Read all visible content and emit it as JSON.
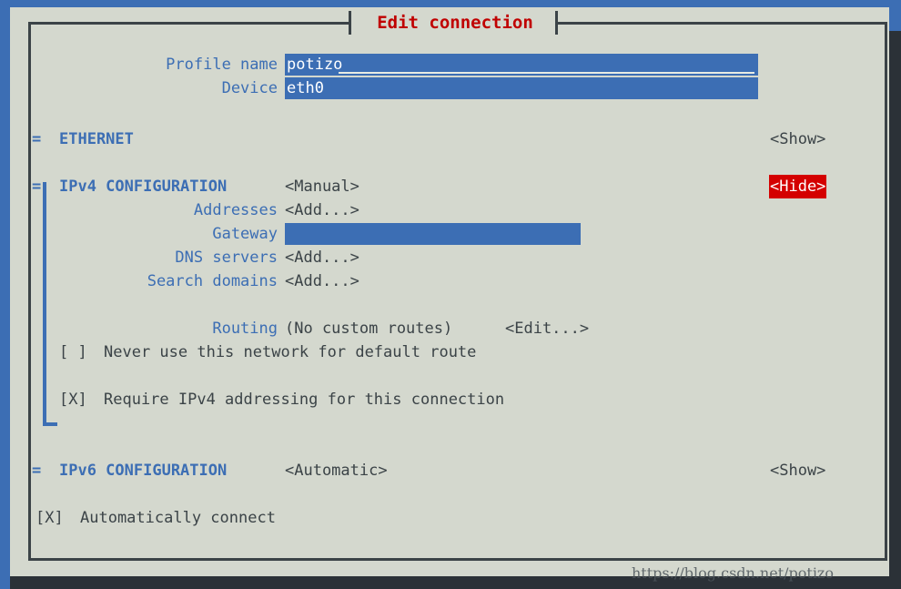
{
  "window": {
    "title": "Edit connection",
    "title_color": "#c00000",
    "background": "#d4d8ce",
    "border_color": "#3b4347",
    "accent_color": "#3c6eb4",
    "selected_bg": "#d40000"
  },
  "form": {
    "profile_name": {
      "label": "Profile name",
      "value": "potizo"
    },
    "device": {
      "label": "Device",
      "value": "eth0"
    }
  },
  "sections": {
    "ethernet": {
      "marker": "=",
      "title": "ETHERNET",
      "toggle": "<Show>",
      "expanded": false
    },
    "ipv4": {
      "marker": "=",
      "title": "IPv4 CONFIGURATION",
      "mode": "<Manual>",
      "toggle": "<Hide>",
      "expanded": true,
      "fields": [
        {
          "label": "Addresses",
          "value": "<Add...>",
          "type": "button"
        },
        {
          "label": "Gateway",
          "value": "",
          "type": "entry"
        },
        {
          "label": "DNS servers",
          "value": "<Add...>",
          "type": "button"
        },
        {
          "label": "Search domains",
          "value": "<Add...>",
          "type": "button"
        }
      ],
      "routing": {
        "label": "Routing",
        "status": "(No custom routes)",
        "edit": "<Edit...>"
      },
      "checkboxes": [
        {
          "box": "[ ]",
          "checked": false,
          "label": "Never use this network for default route"
        },
        {
          "box": "[X]",
          "checked": true,
          "label": "Require IPv4 addressing for this connection"
        }
      ]
    },
    "ipv6": {
      "marker": "=",
      "title": "IPv6 CONFIGURATION",
      "mode": "<Automatic>",
      "toggle": "<Show>",
      "expanded": false
    }
  },
  "global_checkbox": {
    "box": "[X]",
    "checked": true,
    "label": "Automatically connect"
  },
  "scrollbar": {
    "up_arrow": "↑",
    "down_arrow": "↓"
  },
  "watermark": {
    "text": "https://blog.csdn.net/potizo"
  }
}
